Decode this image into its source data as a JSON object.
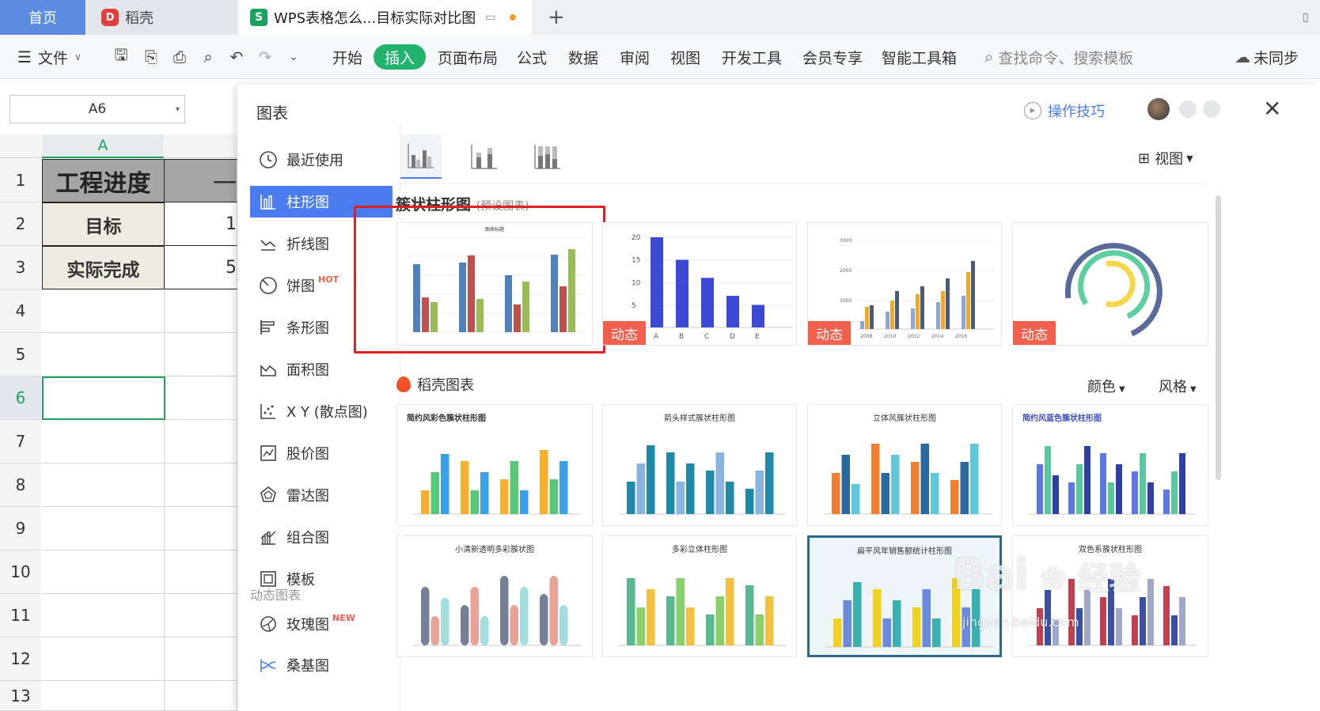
{
  "tabs": {
    "home": "首页",
    "daoke": "稻壳",
    "document": "WPS表格怎么...目标实际对比图",
    "sheet_icon": "S",
    "daoke_icon": "D"
  },
  "toolbar": {
    "file": "文件",
    "menus": [
      "开始",
      "插入",
      "页面布局",
      "公式",
      "数据",
      "审阅",
      "视图",
      "开发工具",
      "会员专享",
      "智能工具箱"
    ],
    "search_placeholder": "查找命令、搜索模板",
    "sync": "未同步"
  },
  "sheet": {
    "name_box": "A6",
    "column_a": "A",
    "rows": [
      "1",
      "2",
      "3",
      "4",
      "5",
      "6",
      "7",
      "8",
      "9",
      "10",
      "11",
      "12",
      "13"
    ],
    "cells": {
      "a1": "工程进度",
      "a2": "目标",
      "a3": "实际完成",
      "b1": "一",
      "b2": "1",
      "b3": "5"
    }
  },
  "dialog": {
    "title": "图表",
    "tips": "操作技巧",
    "view": "视图",
    "nav": [
      "最近使用",
      "柱形图",
      "折线图",
      "饼图",
      "条形图",
      "面积图",
      "X Y (散点图)",
      "股价图",
      "雷达图",
      "组合图",
      "模板"
    ],
    "pie_badge": "HOT",
    "dynamic_section": "动态图表",
    "rose": "玫瑰图",
    "rose_badge": "NEW",
    "sankey": "桑基图",
    "section_title": "簇状柱形图",
    "section_subtitle": "(预设图表)",
    "dynamic_badge": "动态",
    "daoke_section": "稻壳图表",
    "color_filter": "颜色",
    "style_filter": "风格"
  },
  "templates": [
    {
      "title": "简约风彩色簇状柱形图"
    },
    {
      "title": "箭头样式簇状柱形图"
    },
    {
      "title": "立体风簇状柱形图"
    },
    {
      "title": "简约风蓝色簇状柱形图"
    },
    {
      "title": "小清新透明多彩簇状图"
    },
    {
      "title": "多彩立体柱形图"
    },
    {
      "title": "扁平风年销售额统计柱形图"
    },
    {
      "title": "双色系簇状柱形图"
    }
  ],
  "preview_tiles": {
    "t1_title": "图表标题",
    "t2": {
      "y_ticks": [
        "20",
        "15",
        "10",
        "5"
      ],
      "categories": [
        "A",
        "B",
        "C",
        "D",
        "E"
      ],
      "values": [
        20,
        15,
        11,
        7,
        5
      ]
    },
    "t3": {
      "y_ticks": [
        "3000",
        "2000",
        "1000"
      ],
      "x_ticks": [
        "2008",
        "2010",
        "2012",
        "2014",
        "2016"
      ]
    }
  },
  "watermark": {
    "text": "Bai",
    "text2": "经验",
    "url": "jingyan.baidu.com"
  },
  "colors": {
    "accent_green": "#22b36c",
    "active_blue": "#4a7cf0",
    "dynamic_red": "#f0604c",
    "highlight_red": "#e02020"
  }
}
